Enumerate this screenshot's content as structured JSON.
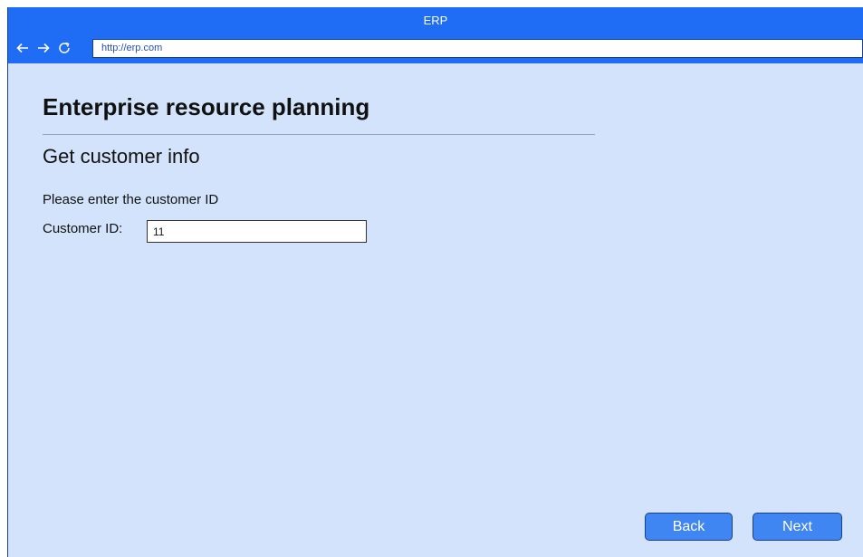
{
  "window": {
    "title": "ERP"
  },
  "navigation": {
    "url": "http://erp.com",
    "back_icon": "arrow-left-icon",
    "forward_icon": "arrow-right-icon",
    "reload_icon": "reload-icon"
  },
  "page": {
    "title": "Enterprise resource planning",
    "subtitle": "Get customer info",
    "instruction": "Please enter the customer ID",
    "customer_id_label": "Customer ID:",
    "customer_id_value": "11"
  },
  "buttons": {
    "back_label": "Back",
    "next_label": "Next"
  },
  "colors": {
    "accent": "#1f6cf5",
    "page_background": "#d3e3fb",
    "button": "#3f86f3"
  }
}
